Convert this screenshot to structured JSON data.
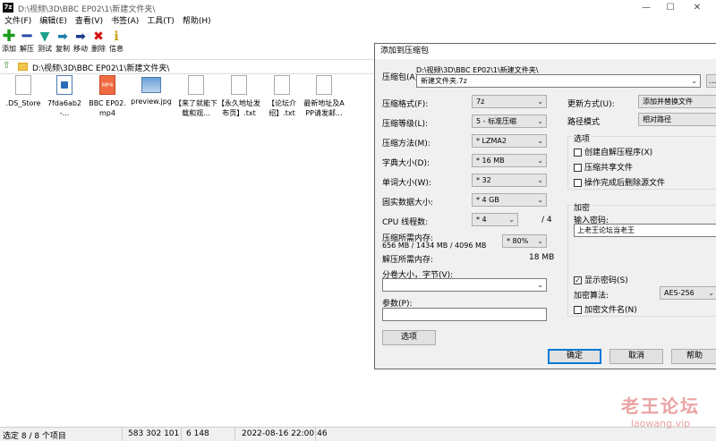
{
  "window": {
    "title": "D:\\视频\\3D\\BBC EP02\\1\\新建文件夹\\",
    "icon": "7z-app-icon"
  },
  "menu": [
    "文件(F)",
    "编辑(E)",
    "查看(V)",
    "书签(A)",
    "工具(T)",
    "帮助(H)"
  ],
  "toolbar": [
    {
      "label": "添加",
      "icon": "add-icon",
      "color": "#1a9a1a"
    },
    {
      "label": "解压",
      "icon": "extract-icon",
      "color": "#2b4aa8"
    },
    {
      "label": "测试",
      "icon": "test-icon",
      "color": "#1aa08a"
    },
    {
      "label": "复制",
      "icon": "copy-icon",
      "color": "#1a7fa8"
    },
    {
      "label": "移动",
      "icon": "move-icon",
      "color": "#1a3a8a"
    },
    {
      "label": "删除",
      "icon": "delete-icon",
      "color": "#d01010"
    },
    {
      "label": "信息",
      "icon": "info-icon",
      "color": "#c8a000"
    }
  ],
  "pathbar": {
    "path": "D:\\视频\\3D\\BBC EP02\\1\\新建文件夹\\"
  },
  "files": [
    {
      "name": ".DS_Store",
      "type": "doc"
    },
    {
      "name": "7fda6ab2-...",
      "type": "pdf"
    },
    {
      "name": "BBC EP02.mp4",
      "type": "mp4",
      "icon_text": "MP4"
    },
    {
      "name": "preview.jpg",
      "type": "img"
    },
    {
      "name": "【来了就能下载和观...",
      "type": "doc"
    },
    {
      "name": "【永久地址发布页】.txt",
      "type": "doc"
    },
    {
      "name": "【论坛介绍】.txt",
      "type": "doc"
    },
    {
      "name": "最新地址及APP请发邮...",
      "type": "doc"
    }
  ],
  "status": {
    "selected": "选定 8 / 8 个项目",
    "size1": "583 302 101",
    "size2": "6 148",
    "modified": "2022-08-16 22:00:46"
  },
  "dialog": {
    "title": "添加到压缩包",
    "archive_label": "压缩包(A)",
    "archive_path": "D:\\视频\\3D\\BBC EP02\\1\\新建文件夹\\",
    "archive_name": "新建文件夹.7z",
    "format_label": "压缩格式(F):",
    "format_value": "7z",
    "level_label": "压缩等级(L):",
    "level_value": "5 - 标准压缩",
    "method_label": "压缩方法(M):",
    "method_value": "* LZMA2",
    "dict_label": "字典大小(D):",
    "dict_value": "* 16 MB",
    "word_label": "单词大小(W):",
    "word_value": "* 32",
    "solid_label": "固实数据大小:",
    "solid_value": "* 4 GB",
    "cpu_label": "CPU 线程数:",
    "cpu_value": "* 4",
    "cpu_max": "/ 4",
    "mem_comp_label": "压缩所需内存:",
    "mem_comp_value": "656 MB / 1434 MB / 4096 MB",
    "mem_percent": "* 80%",
    "mem_decomp_label": "解压所需内存:",
    "mem_decomp_value": "18 MB",
    "split_label": "分卷大小，字节(V):",
    "split_value": "",
    "params_label": "参数(P):",
    "params_value": "",
    "options_button": "选项",
    "update_label": "更新方式(U):",
    "update_value": "添加并替换文件",
    "pathmode_label": "路径模式",
    "pathmode_value": "相对路径",
    "options_group": "选项",
    "opt_sfx": "创建自解压程序(X)",
    "opt_shared": "压缩共享文件",
    "opt_delete": "操作完成后删除源文件",
    "encrypt_group": "加密",
    "password_label": "输入密码:",
    "password_value": "上老王论坛当老王",
    "show_password": "显示密码(S)",
    "show_password_checked": "✓",
    "enc_method_label": "加密算法:",
    "enc_method_value": "AES-256",
    "encrypt_names": "加密文件名(N)",
    "ok": "确定",
    "cancel": "取消",
    "help": "帮助"
  },
  "watermark": {
    "line1": "老王论坛",
    "line2": "laowang.vip"
  }
}
